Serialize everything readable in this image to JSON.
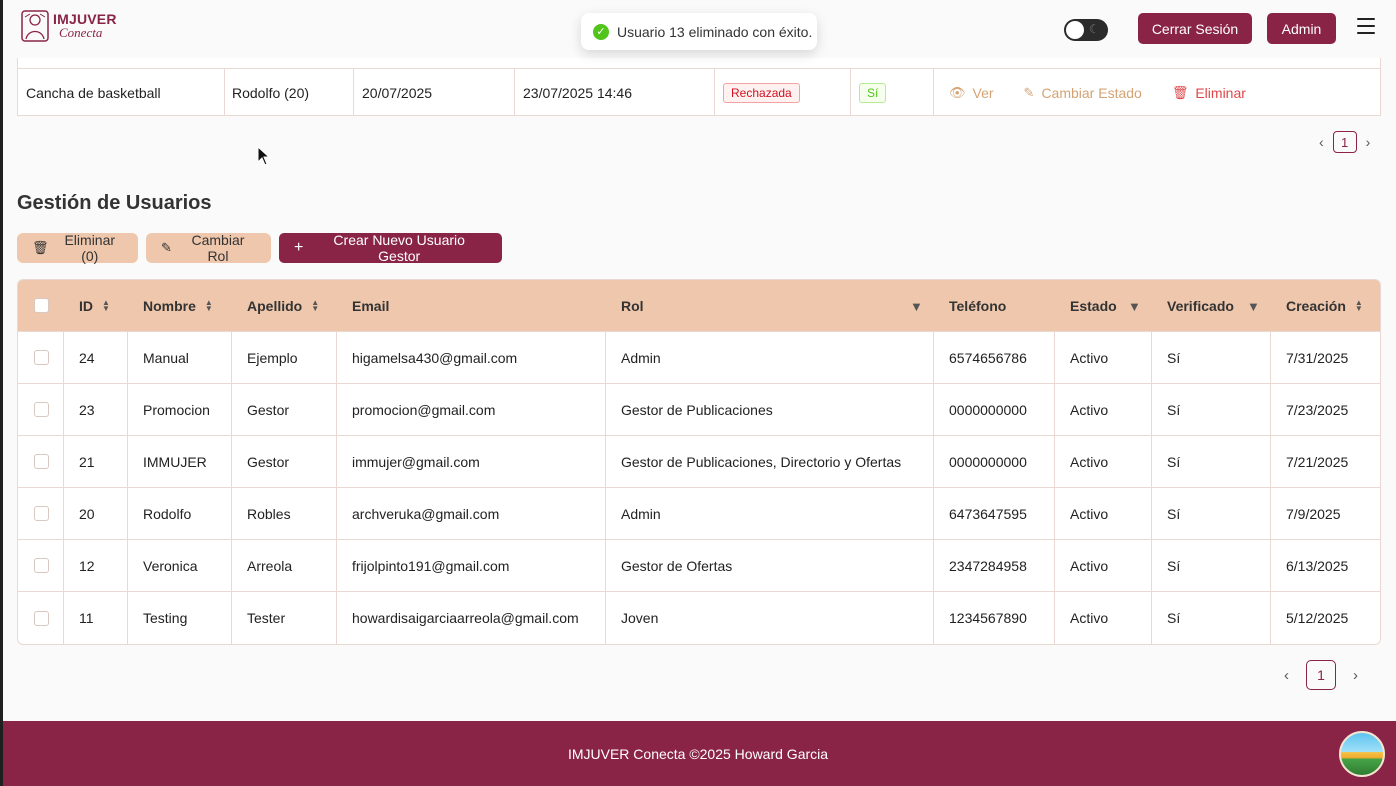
{
  "app": {
    "logo_title": "IMJUVER",
    "logo_subtitle": "Conecta"
  },
  "toast": {
    "message": "Usuario 13 eliminado con éxito.",
    "icon": "check-circle-icon"
  },
  "header": {
    "logout_label": "Cerrar Sesión",
    "admin_label": "Admin",
    "theme_toggle_icon": "moon-icon",
    "menu_icon": "hamburger-icon"
  },
  "reservations": {
    "row": {
      "space": "Cancha de basketball",
      "user": "Rodolfo (20)",
      "date": "20/07/2025",
      "created": "23/07/2025 14:46",
      "status": "Rechazada",
      "confirmed": "Sí",
      "actions": {
        "view": "Ver",
        "change_state": "Cambiar Estado",
        "delete": "Eliminar"
      }
    },
    "pagination": {
      "current_page": "1"
    }
  },
  "users": {
    "title": "Gestión de Usuarios",
    "toolbar": {
      "delete_label": "Eliminar (0)",
      "change_role_label": "Cambiar Rol",
      "create_label": "Crear Nuevo Usuario Gestor"
    },
    "columns": {
      "id": "ID",
      "nombre": "Nombre",
      "apellido": "Apellido",
      "email": "Email",
      "rol": "Rol",
      "telefono": "Teléfono",
      "estado": "Estado",
      "verificado": "Verificado",
      "creacion": "Creación"
    },
    "rows": [
      {
        "id": "24",
        "nombre": "Manual",
        "apellido": "Ejemplo",
        "email": "higamelsa430@gmail.com",
        "rol": "Admin",
        "telefono": "6574656786",
        "estado": "Activo",
        "verificado": "Sí",
        "creacion": "7/31/2025"
      },
      {
        "id": "23",
        "nombre": "Promocion",
        "apellido": "Gestor",
        "email": "promocion@gmail.com",
        "rol": "Gestor de Publicaciones",
        "telefono": "0000000000",
        "estado": "Activo",
        "verificado": "Sí",
        "creacion": "7/23/2025"
      },
      {
        "id": "21",
        "nombre": "IMMUJER",
        "apellido": "Gestor",
        "email": "immujer@gmail.com",
        "rol": "Gestor de Publicaciones, Directorio y Ofertas",
        "telefono": "0000000000",
        "estado": "Activo",
        "verificado": "Sí",
        "creacion": "7/21/2025"
      },
      {
        "id": "20",
        "nombre": "Rodolfo",
        "apellido": "Robles",
        "email": "archveruka@gmail.com",
        "rol": "Admin",
        "telefono": "6473647595",
        "estado": "Activo",
        "verificado": "Sí",
        "creacion": "7/9/2025"
      },
      {
        "id": "12",
        "nombre": "Veronica",
        "apellido": "Arreola",
        "email": "frijolpinto191@gmail.com",
        "rol": "Gestor de Ofertas",
        "telefono": "2347284958",
        "estado": "Activo",
        "verificado": "Sí",
        "creacion": "6/13/2025"
      },
      {
        "id": "11",
        "nombre": "Testing",
        "apellido": "Tester",
        "email": "howardisaigarciaarreola@gmail.com",
        "rol": "Joven",
        "telefono": "1234567890",
        "estado": "Activo",
        "verificado": "Sí",
        "creacion": "5/12/2025"
      }
    ],
    "pagination": {
      "current_page": "1"
    }
  },
  "footer": {
    "text": "IMJUVER Conecta ©2025 Howard Garcia"
  },
  "colors": {
    "brand": "#8a2446",
    "header_row": "#eec7ac",
    "success": "#52c41a",
    "danger": "#e0464a",
    "warning_link": "#d4a373"
  }
}
